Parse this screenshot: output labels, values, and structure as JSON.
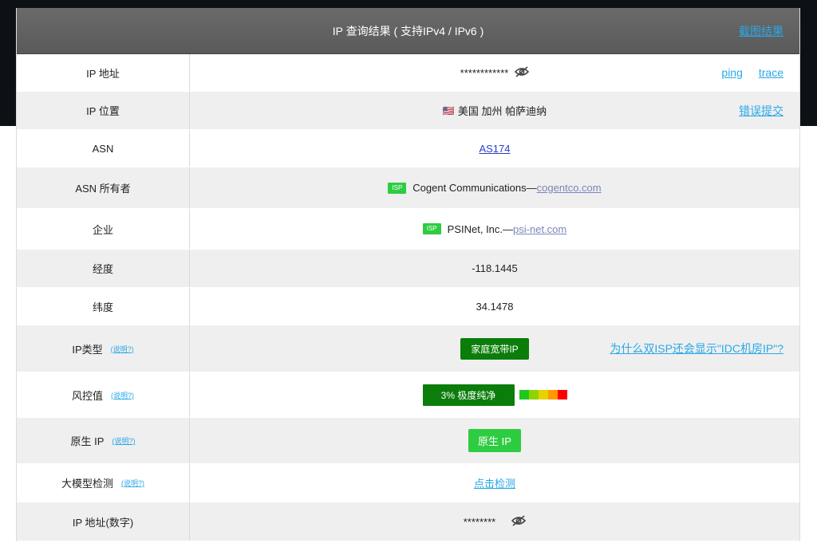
{
  "header": {
    "title": "IP 查询结果 ( 支持IPv4 / IPv6 )",
    "screenshot_link": "截图结果"
  },
  "rows": {
    "ip_address": {
      "label": "IP 地址",
      "value": "************",
      "ping": "ping",
      "trace": "trace"
    },
    "ip_location": {
      "label": "IP 位置",
      "flag": "🇺🇸",
      "value": "美国 加州 帕萨迪纳",
      "report": "错误提交"
    },
    "asn": {
      "label": "ASN",
      "value": "AS174"
    },
    "asn_owner": {
      "label": "ASN 所有者",
      "badge": "ISP",
      "name": "Cogent Communications—",
      "domain": "cogentco.com"
    },
    "enterprise": {
      "label": "企业",
      "badge": "ISP",
      "name": "PSINet, Inc.—",
      "domain": "psi-net.com"
    },
    "longitude": {
      "label": "经度",
      "value": "-118.1445"
    },
    "latitude": {
      "label": "纬度",
      "value": "34.1478"
    },
    "ip_type": {
      "label": "IP类型",
      "help": "(说明?)",
      "value": "家庭宽带IP",
      "question": "为什么双ISP还会显示\"IDC机房IP\"?"
    },
    "risk": {
      "label": "风控值",
      "help": "(说明?)",
      "value": "3%   极度纯净",
      "level": 0.03
    },
    "native_ip": {
      "label": "原生 IP",
      "help": "(说明?)",
      "value": "原生 IP"
    },
    "llm_detect": {
      "label": "大模型检测",
      "help": "(说明?)",
      "value": "点击检测"
    },
    "ip_numeric": {
      "label": "IP 地址(数字)",
      "value": "********"
    }
  },
  "colors": {
    "header_bg": "#5f5f5f",
    "link_blue": "#29a8e8",
    "green_dark": "#0b7d0b",
    "green_light": "#2ecc40",
    "risk_scale": [
      "#1ec81e",
      "#8fd400",
      "#e6d200",
      "#ff9900",
      "#ff0000"
    ]
  }
}
